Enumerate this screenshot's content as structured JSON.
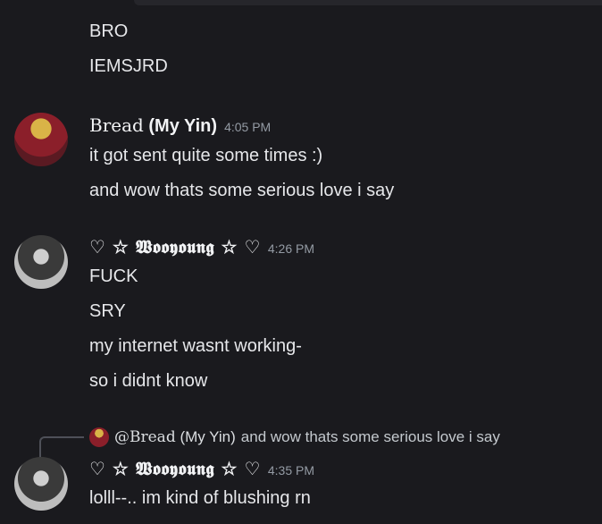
{
  "messages_top": [
    "BRO",
    "IEMSJRD"
  ],
  "msg1": {
    "username_main": "Bread",
    "username_suffix": "(My Yin)",
    "timestamp": "4:05 PM",
    "lines": [
      "it got sent quite some times :)",
      "and wow thats some serious love i say"
    ]
  },
  "msg2": {
    "username": "♡ ☆ 𝖂𝖔𝖔𝖞𝖔𝖚𝖓𝖌 ☆ ♡",
    "timestamp": "4:26 PM",
    "lines": [
      "FUCK",
      "SRY",
      "my internet wasnt working-",
      "so  i didnt know"
    ]
  },
  "reply": {
    "mention": "@Bread",
    "suffix": "(My Yin)",
    "text": "and wow thats some serious love i say"
  },
  "msg3": {
    "username": "♡ ☆ 𝖂𝖔𝖔𝖞𝖔𝖚𝖓𝖌 ☆ ♡",
    "timestamp": "4:35 PM",
    "lines": [
      "lolll--.. im kind of blushing rn"
    ]
  }
}
